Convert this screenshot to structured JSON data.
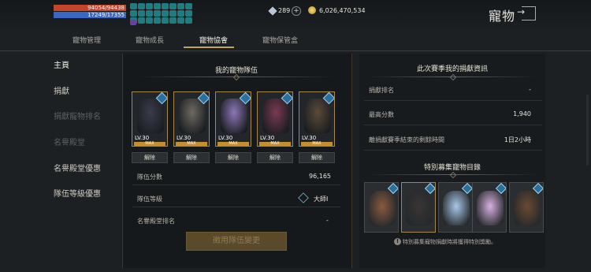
{
  "status": {
    "hp": "94054/94438",
    "mp": "17249/17355",
    "buff_count": 24
  },
  "currency": {
    "gems": "289",
    "gold": "6,026,470,534"
  },
  "header": {
    "title": "寵物"
  },
  "tabs": [
    "寵物管理",
    "寵物成長",
    "寵物協會",
    "寵物保管盒"
  ],
  "sidebar": {
    "items": [
      "主頁",
      "捐獻",
      "捐獻寵物排名",
      "名譽殿堂",
      "名譽殿堂優惠",
      "隊伍等級優惠"
    ]
  },
  "team": {
    "title": "我的寵物隊伍",
    "pets": [
      {
        "level": "LV.30",
        "max": "MAX",
        "remove": "解除",
        "color": "#3a3d4a"
      },
      {
        "level": "LV.30",
        "max": "MAX",
        "remove": "解除",
        "color": "#6e6a62"
      },
      {
        "level": "LV.30",
        "max": "MAX",
        "remove": "解除",
        "color": "#8d76b8"
      },
      {
        "level": "LV.30",
        "max": "MAX",
        "remove": "解除",
        "color": "#7a3a52"
      },
      {
        "level": "LV.30",
        "max": "MAX",
        "remove": "解除",
        "color": "#5c4a3a"
      }
    ],
    "score_label": "隊伍分數",
    "score_value": "96,165",
    "grade_label": "隊伍等級",
    "grade_value": "大師I",
    "hall_label": "名譽殿堂排名",
    "hall_value": "-",
    "apply_button": "徵用隊伍變更"
  },
  "season": {
    "title": "此次賽季我的捐獻資訊",
    "rows": [
      {
        "label": "捐獻排名",
        "value": "-"
      },
      {
        "label": "最高分數",
        "value": "1,940"
      },
      {
        "label": "離捐獻賽季結束的剩餘時間",
        "value": "1日2小時"
      }
    ]
  },
  "special": {
    "title": "特別募集寵物目錄",
    "pets": [
      {
        "color": "#8a5a40"
      },
      {
        "color": "#3a3534"
      },
      {
        "color": "#a8c8e8"
      },
      {
        "color": "#d8b0e0"
      },
      {
        "color": "#6a4a32"
      }
    ],
    "notice": "特別募集寵物捐獻時將獲得特別獎勵。"
  }
}
